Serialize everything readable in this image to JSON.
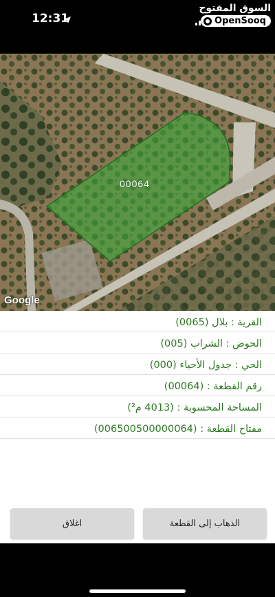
{
  "status_bar": {
    "time": "12:31",
    "watermark_arabic": "السوق المفتوح",
    "watermark_brand": "OpenSooq"
  },
  "map": {
    "parcel_label": "00064",
    "attribution": "Google",
    "parcel_color": "#3ca83c"
  },
  "info": {
    "village": "القرية : بلال (0065)",
    "basin": "الحوض : الشراب (005)",
    "neighborhood": "الحي : جدول الأحياء (000)",
    "parcel_number": "رقم القطعة : (00064)",
    "area": "المساحة المحسوبة : (4013 م²)",
    "parcel_key": "مفتاح القطعة : (006500500000064)"
  },
  "buttons": {
    "go_to_parcel": "الذهاب إلى القطعة",
    "close": "اغلاق"
  },
  "colors": {
    "text_green": "#2d7a22",
    "button_gray": "#d9d9d9"
  }
}
